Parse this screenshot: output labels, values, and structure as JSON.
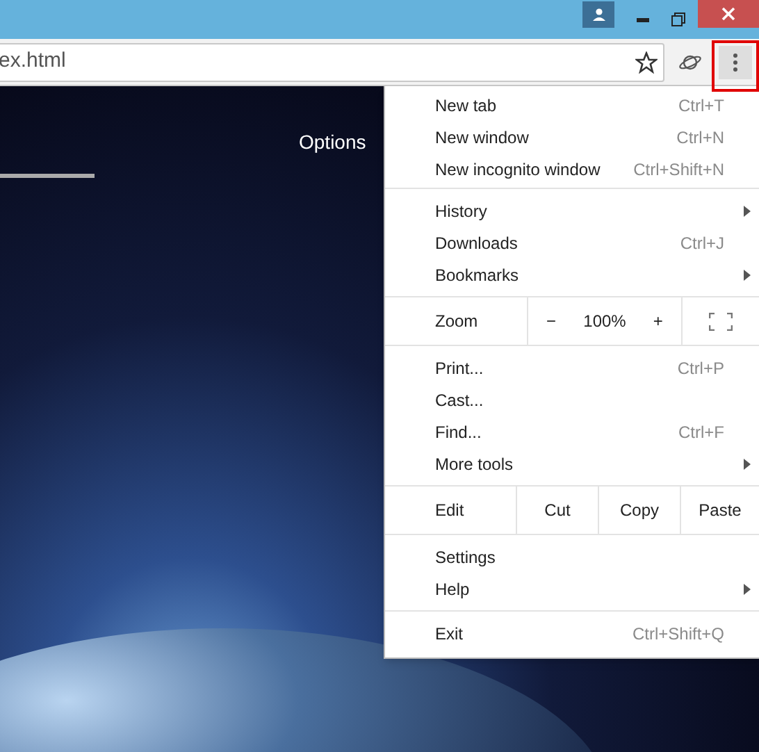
{
  "address_bar": {
    "url": "ex.html"
  },
  "menu_button": {
    "highlighted": true
  },
  "page": {
    "options_link": "Options"
  },
  "menu": {
    "groups": [
      [
        {
          "kind": "item",
          "label": "New tab",
          "shortcut": "Ctrl+T",
          "submenu": false
        },
        {
          "kind": "item",
          "label": "New window",
          "shortcut": "Ctrl+N",
          "submenu": false
        },
        {
          "kind": "item",
          "label": "New incognito window",
          "shortcut": "Ctrl+Shift+N",
          "submenu": false
        }
      ],
      [
        {
          "kind": "item",
          "label": "History",
          "submenu": true
        },
        {
          "kind": "item",
          "label": "Downloads",
          "shortcut": "Ctrl+J",
          "submenu": false
        },
        {
          "kind": "item",
          "label": "Bookmarks",
          "submenu": true
        }
      ],
      [
        {
          "kind": "zoom",
          "label": "Zoom",
          "minus": "−",
          "value": "100%",
          "plus": "+"
        }
      ],
      [
        {
          "kind": "item",
          "label": "Print...",
          "shortcut": "Ctrl+P",
          "submenu": false
        },
        {
          "kind": "item",
          "label": "Cast...",
          "submenu": false
        },
        {
          "kind": "item",
          "label": "Find...",
          "shortcut": "Ctrl+F",
          "submenu": false
        },
        {
          "kind": "item",
          "label": "More tools",
          "submenu": true
        }
      ],
      [
        {
          "kind": "edit",
          "label": "Edit",
          "actions": [
            "Cut",
            "Copy",
            "Paste"
          ]
        }
      ],
      [
        {
          "kind": "item",
          "label": "Settings",
          "submenu": false
        },
        {
          "kind": "item",
          "label": "Help",
          "submenu": true
        }
      ],
      [
        {
          "kind": "item",
          "label": "Exit",
          "shortcut": "Ctrl+Shift+Q",
          "submenu": false
        }
      ]
    ]
  }
}
